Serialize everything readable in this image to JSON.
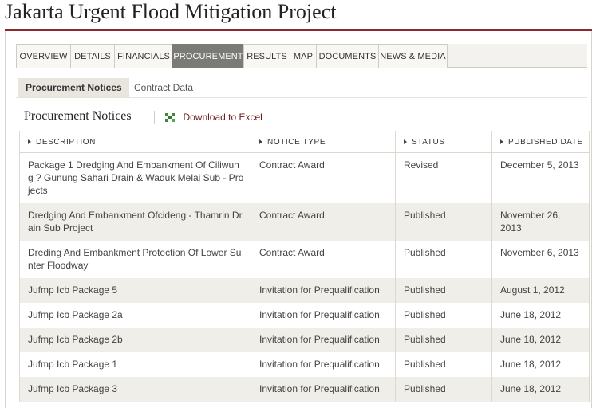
{
  "project": {
    "title": "Jakarta Urgent Flood Mitigation Project"
  },
  "tabs": [
    {
      "label": "OVERVIEW"
    },
    {
      "label": "DETAILS"
    },
    {
      "label": "FINANCIALS"
    },
    {
      "label": "PROCUREMENT",
      "active": true
    },
    {
      "label": "RESULTS"
    },
    {
      "label": "MAP"
    },
    {
      "label": "DOCUMENTS"
    },
    {
      "label": "NEWS & MEDIA"
    }
  ],
  "subtabs": [
    {
      "label": "Procurement Notices",
      "active": true
    },
    {
      "label": "Contract Data"
    }
  ],
  "section": {
    "title": "Procurement Notices",
    "excel_label": "Download to Excel",
    "excel_icon": "excel-icon"
  },
  "colors": {
    "accent": "#8b2a2a",
    "link": "#7a1f1f",
    "active_tab": "#7a7a76",
    "row_alt": "#efeee9"
  },
  "table": {
    "headers": [
      "DESCRIPTION",
      "NOTICE TYPE",
      "STATUS",
      "PUBLISHED DATE"
    ],
    "rows": [
      {
        "description": "Package 1 Dredging And Embankment Of Ciliwung ? Gunung Sahari Drain & Waduk Melai Sub - Projects",
        "notice_type": "Contract Award",
        "status": "Revised",
        "date": "December 5, 2013"
      },
      {
        "description": "Dredging And Embankment Ofcideng - Thamrin Drain Sub Project",
        "notice_type": "Contract Award",
        "status": "Published",
        "date": "November 26, 2013"
      },
      {
        "description": "Dreding And Embankment Protection Of Lower Sunter Floodway",
        "notice_type": "Contract Award",
        "status": "Published",
        "date": "November 6, 2013"
      },
      {
        "description": "Jufmp Icb Package 5",
        "notice_type": "Invitation for Prequalification",
        "status": "Published",
        "date": "August 1, 2012"
      },
      {
        "description": "Jufmp Icb Package 2a",
        "notice_type": "Invitation for Prequalification",
        "status": "Published",
        "date": "June 18, 2012"
      },
      {
        "description": "Jufmp Icb Package 2b",
        "notice_type": "Invitation for Prequalification",
        "status": "Published",
        "date": "June 18, 2012"
      },
      {
        "description": "Jufmp Icb Package 1",
        "notice_type": "Invitation for Prequalification",
        "status": "Published",
        "date": "June 18, 2012"
      },
      {
        "description": "Jufmp Icb Package 3",
        "notice_type": "Invitation for Prequalification",
        "status": "Published",
        "date": "June 18, 2012"
      }
    ]
  }
}
